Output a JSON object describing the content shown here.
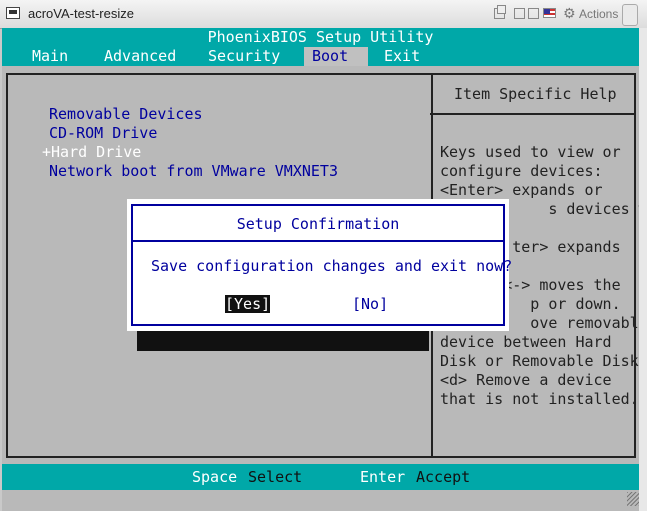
{
  "window": {
    "title": "acroVA-test-resize",
    "actions_label": "Actions"
  },
  "bios": {
    "title": "PhoenixBIOS Setup Utility",
    "menu": [
      "Main",
      "Advanced",
      "Security",
      "Boot",
      "Exit"
    ],
    "active_menu": "Boot",
    "boot_items": [
      "Removable Devices",
      "CD-ROM Drive",
      "+Hard Drive",
      "Network boot from VMware VMXNET3"
    ],
    "help_title": "Item Specific Help",
    "help_lines": [
      "Keys used to view or",
      "configure devices:",
      "<Enter> expands or",
      "            s devices with",
      "",
      "        ter> expands",
      "",
      "       <-> moves the",
      "          p or down.",
      "          ove removable",
      "device between Hard",
      "Disk or Removable Disk",
      "<d> Remove a device",
      "that is not installed."
    ],
    "footer": [
      {
        "key": "Space",
        "desc": "Select"
      },
      {
        "key": "Enter",
        "desc": "Accept"
      }
    ]
  },
  "dialog": {
    "title": "Setup Confirmation",
    "message": "Save configuration changes and exit now?",
    "yes_label": "[Yes]",
    "no_label": "[No]"
  },
  "colors": {
    "bios_cyan": "#00a8a8",
    "bios_gray": "#b9b9b9",
    "bios_blue": "#00009e"
  }
}
